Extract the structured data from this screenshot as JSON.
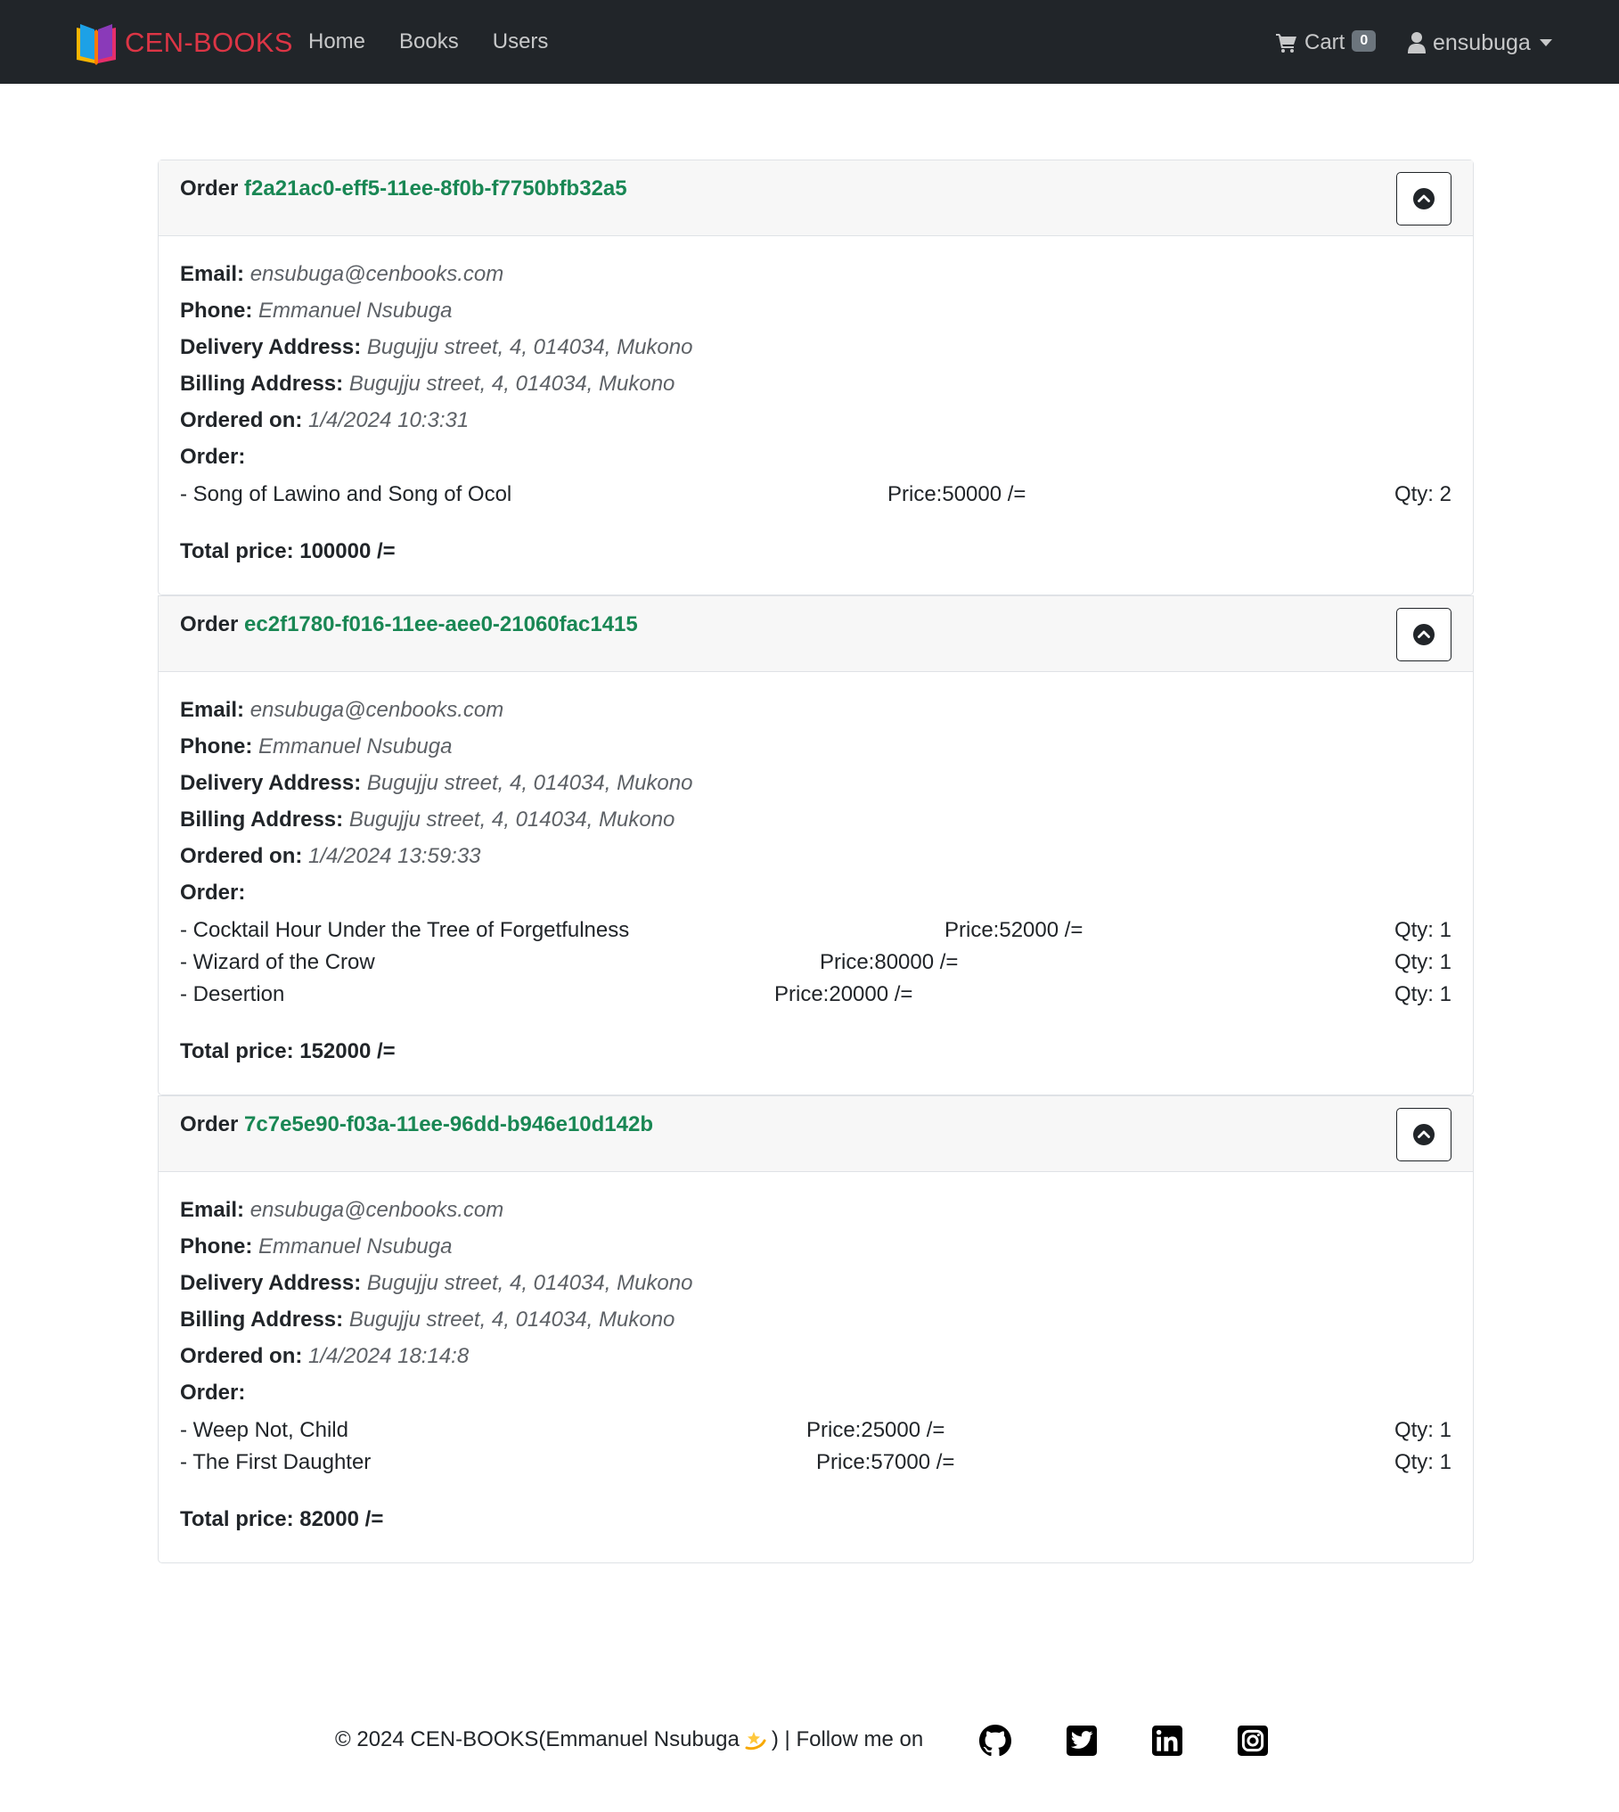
{
  "navbar": {
    "brand": "CEN-BOOKS",
    "links": [
      "Home",
      "Books",
      "Users"
    ],
    "cart_label": "Cart",
    "cart_count": "0",
    "username": "ensubuga"
  },
  "labels": {
    "order": "Order",
    "email": "Email:",
    "phone": "Phone:",
    "delivery": "Delivery Address:",
    "billing": "Billing Address:",
    "ordered_on": "Ordered on:",
    "order_items": "Order:"
  },
  "orders": [
    {
      "id": "f2a21ac0-eff5-11ee-8f0b-f7750bfb32a5",
      "email": "ensubuga@cenbooks.com",
      "phone": "Emmanuel Nsubuga",
      "delivery_address": "Bugujju street, 4, 014034, Mukono",
      "billing_address": "Bugujju street, 4, 014034, Mukono",
      "ordered_on": "1/4/2024 10:3:31",
      "items": [
        {
          "title": "- Song of Lawino and Song of Ocol",
          "price": "Price:50000 /=",
          "qty": "Qty: 2"
        }
      ],
      "total": "Total price: 100000 /="
    },
    {
      "id": "ec2f1780-f016-11ee-aee0-21060fac1415",
      "email": "ensubuga@cenbooks.com",
      "phone": "Emmanuel Nsubuga",
      "delivery_address": "Bugujju street, 4, 014034, Mukono",
      "billing_address": "Bugujju street, 4, 014034, Mukono",
      "ordered_on": "1/4/2024 13:59:33",
      "items": [
        {
          "title": "- Cocktail Hour Under the Tree of Forgetfulness",
          "price": "Price:52000 /=",
          "qty": "Qty: 1"
        },
        {
          "title": "- Wizard of the Crow",
          "price": "Price:80000 /=",
          "qty": "Qty: 1"
        },
        {
          "title": "- Desertion",
          "price": "Price:20000 /=",
          "qty": "Qty: 1"
        }
      ],
      "total": "Total price: 152000 /="
    },
    {
      "id": "7c7e5e90-f03a-11ee-96dd-b946e10d142b",
      "email": "ensubuga@cenbooks.com",
      "phone": "Emmanuel Nsubuga",
      "delivery_address": "Bugujju street, 4, 014034, Mukono",
      "billing_address": "Bugujju street, 4, 014034, Mukono",
      "ordered_on": "1/4/2024 18:14:8",
      "items": [
        {
          "title": "- Weep Not, Child",
          "price": "Price:25000 /=",
          "qty": "Qty: 1"
        },
        {
          "title": "- The First Daughter",
          "price": "Price:57000 /=",
          "qty": "Qty: 1"
        }
      ],
      "total": "Total price: 82000 /="
    }
  ],
  "footer": {
    "text_before": "© 2024 CEN-BOOKS(Emmanuel Nsubuga",
    "text_after": ") | Follow me on",
    "icons": [
      "github-icon",
      "twitter-icon",
      "linkedin-icon",
      "instagram-icon"
    ]
  },
  "colors": {
    "navbar_bg": "#212529",
    "brand": "#dc3545",
    "order_id": "#198754",
    "badge": "#6c757d"
  }
}
